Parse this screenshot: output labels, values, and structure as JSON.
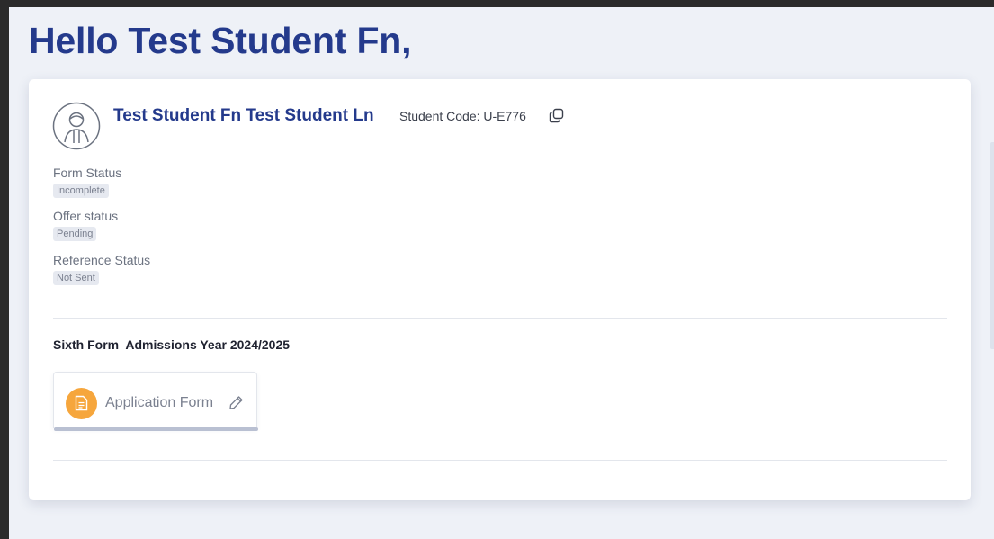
{
  "greeting": "Hello Test Student Fn,",
  "student": {
    "name": "Test Student Fn Test Student Ln",
    "code_text": "Student Code: U-E776"
  },
  "statuses": [
    {
      "label": "Form Status",
      "value": "Incomplete"
    },
    {
      "label": "Offer status",
      "value": "Pending"
    },
    {
      "label": "Reference Status",
      "value": "Not Sent"
    }
  ],
  "section": {
    "title": "Sixth Form  Admissions Year 2024/2025"
  },
  "forms": [
    {
      "label": "Application Form",
      "icon": "document-icon"
    }
  ],
  "colors": {
    "brand": "#243a8c",
    "background": "#eef1f7",
    "badge_bg": "#e6e9f0",
    "form_icon": "#f6a63c"
  }
}
